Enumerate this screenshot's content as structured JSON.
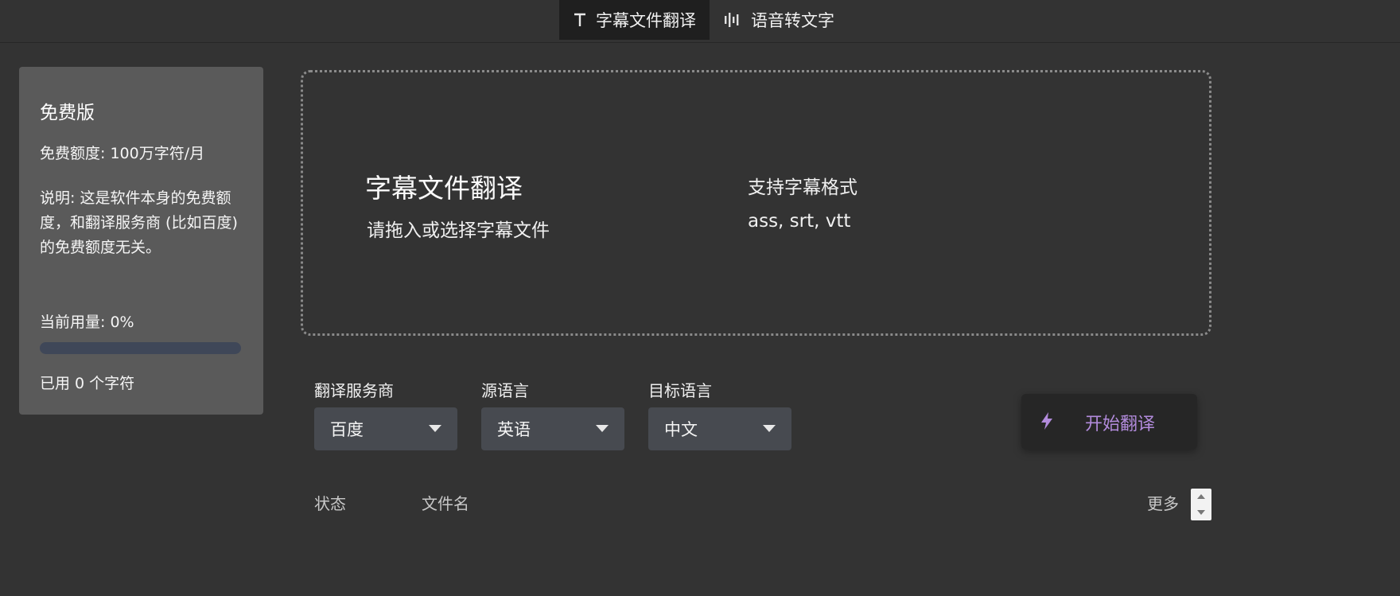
{
  "tabs": [
    {
      "label": "字幕文件翻译",
      "icon": "text-t-icon",
      "active": true
    },
    {
      "label": "语音转文字",
      "icon": "audio-wave-icon",
      "active": false
    }
  ],
  "plan": {
    "title": "免费版",
    "quota": "免费额度: 100万字符/月",
    "description": "说明: 这是软件本身的免费额度，和翻译服务商 (比如百度) 的免费额度无关。",
    "usage_label": "当前用量: 0%",
    "usage_percent": 0,
    "used": "已用 0 个字符"
  },
  "dropzone": {
    "title": "字幕文件翻译",
    "subtitle": "请拖入或选择字幕文件",
    "formats_label": "支持字幕格式",
    "formats": "ass, srt, vtt"
  },
  "options": {
    "provider": {
      "label": "翻译服务商",
      "value": "百度"
    },
    "source": {
      "label": "源语言",
      "value": "英语"
    },
    "target": {
      "label": "目标语言",
      "value": "中文"
    }
  },
  "start_button": {
    "label": "开始翻译",
    "icon": "lightning-icon",
    "color": "#b28bdc"
  },
  "table": {
    "columns": {
      "status": "状态",
      "filename": "文件名",
      "more": "更多"
    }
  },
  "colors": {
    "background": "#333333",
    "panel": "#5a5a5a",
    "accent": "#b28bdc"
  }
}
